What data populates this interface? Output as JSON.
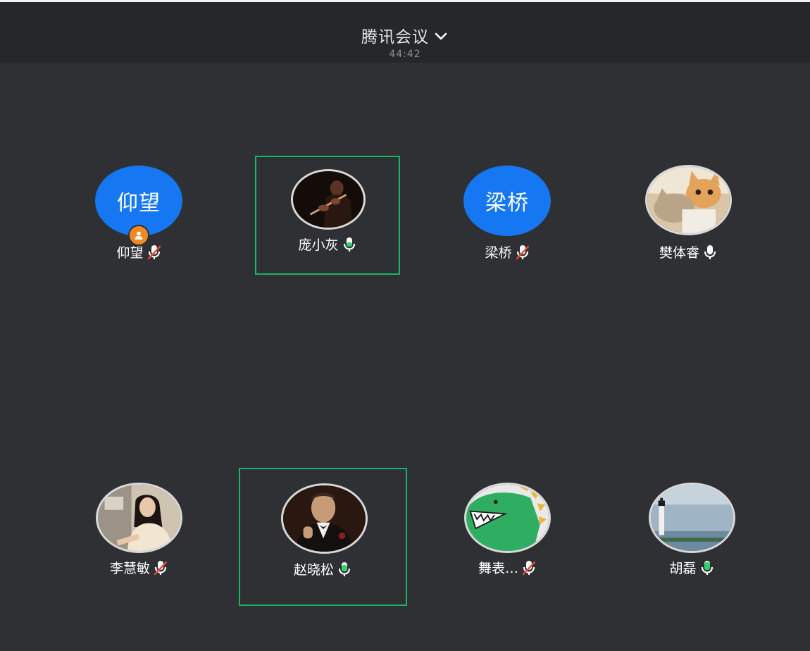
{
  "header": {
    "title": "腾讯会议",
    "timer": "44:42",
    "chevron_icon": "chevron-down-icon"
  },
  "participants": [
    {
      "name": "仰望",
      "avatar_text": "仰望",
      "mic": "muted",
      "host": true
    },
    {
      "name": "庞小灰",
      "avatar": "photo-flute-player",
      "mic": "on",
      "speaking": true
    },
    {
      "name": "梁桥",
      "avatar_text": "梁桥",
      "mic": "muted"
    },
    {
      "name": "樊体睿",
      "avatar": "photo-cat",
      "mic": "on"
    },
    {
      "name": "李慧敏",
      "avatar": "photo-woman",
      "mic": "muted"
    },
    {
      "name": "赵晓松",
      "avatar": "photo-godfather",
      "mic": "on",
      "speaking": true
    },
    {
      "name": "舞表…",
      "avatar": "photo-green-dinosaur",
      "mic": "muted"
    },
    {
      "name": "胡磊",
      "avatar": "photo-lighthouse",
      "mic": "on"
    }
  ],
  "colors": {
    "background": "#2e3033",
    "header": "#25272a",
    "avatar_blue": "#1677f2",
    "speaking_border": "#18b566",
    "mic_active": "#2fd46a",
    "mic_muted_slash": "#e8463a",
    "host_badge": "#f08a24"
  }
}
